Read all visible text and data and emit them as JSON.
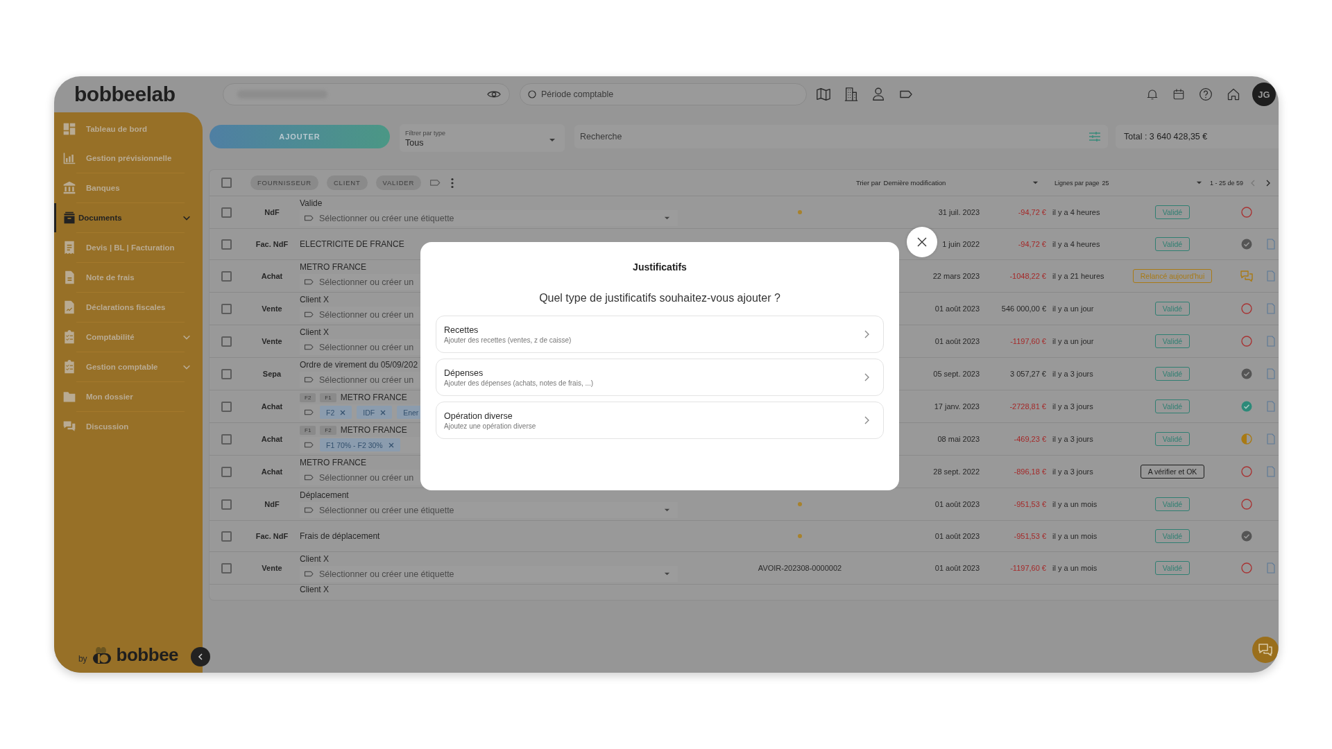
{
  "top_bar": {
    "logo": "bobbeelab",
    "period_field": {
      "placeholder": "Période comptable"
    },
    "avatar": "JG"
  },
  "sidebar": {
    "items": [
      {
        "label": "Tableau de bord",
        "selected": false,
        "expandable": false
      },
      {
        "label": "Gestion prévisionnelle",
        "selected": false,
        "expandable": false
      },
      {
        "label": "Banques",
        "selected": false,
        "expandable": false
      },
      {
        "label": "Documents",
        "selected": true,
        "expandable": true
      },
      {
        "label": "Devis | BL | Facturation",
        "selected": false,
        "expandable": false
      },
      {
        "label": "Note de frais",
        "selected": false,
        "expandable": false
      },
      {
        "label": "Déclarations fiscales",
        "selected": false,
        "expandable": false
      },
      {
        "label": "Comptabilité",
        "selected": false,
        "expandable": true
      },
      {
        "label": "Gestion comptable",
        "selected": false,
        "expandable": true
      },
      {
        "label": "Mon dossier",
        "selected": false,
        "expandable": false
      },
      {
        "label": "Discussion",
        "selected": false,
        "expandable": false
      }
    ],
    "footer": {
      "by": "by",
      "brand": "bobbee"
    }
  },
  "toolbar": {
    "add_button": "AJOUTER",
    "type_filter": {
      "label": "Filtrer par type",
      "value": "Tous"
    },
    "search": {
      "placeholder": "Recherche"
    },
    "total": "Total : 3 640 428,35 €"
  },
  "table": {
    "select_all": {
      "checked": false
    },
    "bulk_actions": [
      {
        "label": "FOURNISSEUR",
        "disabled": true
      },
      {
        "label": "CLIENT",
        "disabled": true
      },
      {
        "label": "VALIDER",
        "disabled": true
      }
    ],
    "sort": {
      "label": "Trier par",
      "value": "Dernière modification"
    },
    "page_size": {
      "label": "Lignes par page",
      "value": "25"
    },
    "pagination": {
      "range": "1 - 25 de 59",
      "previous": {
        "disabled": true
      },
      "next": {
        "disabled": false
      }
    },
    "rows": [
      {
        "kind": "full",
        "checked": false,
        "type": "NdF",
        "label": "Valide",
        "tag_field": {
          "placeholder": "Sélectionner ou créer une étiquette",
          "dropdown": true
        },
        "marker": true,
        "date": "31 juil. 2023",
        "amount": "-94,72 €",
        "negative": true,
        "updated": "il y a 4 heures",
        "badge": {
          "text": "Validé",
          "kind": "validated"
        },
        "status_icon": {
          "kind": "pending"
        },
        "document": false
      },
      {
        "kind": "full",
        "checked": false,
        "type": "Fac. NdF",
        "label": "ELECTRICITE DE FRANCE",
        "marker": false,
        "date": "1 juin 2022",
        "amount": "-94,72 €",
        "negative": true,
        "updated": "il y a 4 heures",
        "badge": {
          "text": "Validé",
          "kind": "validated"
        },
        "status_icon": {
          "kind": "done"
        },
        "document": true
      },
      {
        "kind": "full",
        "checked": false,
        "type": "Achat",
        "label": "METRO FRANCE",
        "tag_field": {
          "placeholder": "Sélectionner ou créer un",
          "dropdown": false
        },
        "marker": false,
        "date": "22 mars 2023",
        "amount": "-1048,22 €",
        "negative": true,
        "updated": "il y a 21 heures",
        "badge": {
          "text": "Relancé aujourd'hui",
          "kind": "reminded"
        },
        "status_icon": {
          "kind": "comment"
        },
        "document": true
      },
      {
        "kind": "full",
        "checked": false,
        "type": "Vente",
        "label": "Client X",
        "tag_field": {
          "placeholder": "Sélectionner ou créer un",
          "dropdown": false
        },
        "marker": false,
        "date": "01 août 2023",
        "amount": "546 000,00 €",
        "negative": false,
        "updated": "il y a un jour",
        "badge": {
          "text": "Validé",
          "kind": "validated"
        },
        "status_icon": {
          "kind": "pending"
        },
        "document": true
      },
      {
        "kind": "full",
        "checked": false,
        "type": "Vente",
        "label": "Client X",
        "tag_field": {
          "placeholder": "Sélectionner ou créer un",
          "dropdown": false
        },
        "marker": false,
        "date": "01 août 2023",
        "amount": "-1197,60 €",
        "negative": true,
        "updated": "il y a un jour",
        "badge": {
          "text": "Validé",
          "kind": "validated"
        },
        "status_icon": {
          "kind": "pending"
        },
        "document": true
      },
      {
        "kind": "full",
        "checked": false,
        "type": "Sepa",
        "label": "Ordre de virement du 05/09/202",
        "tag_field": {
          "placeholder": "Sélectionner ou créer un",
          "dropdown": false
        },
        "marker": false,
        "date": "05 sept. 2023",
        "amount": "3 057,27 €",
        "negative": false,
        "updated": "il y a 3 jours",
        "badge": {
          "text": "Validé",
          "kind": "validated"
        },
        "status_icon": {
          "kind": "done"
        },
        "document": true
      },
      {
        "kind": "full",
        "checked": false,
        "type": "Achat",
        "chips": [
          "F2",
          "F1"
        ],
        "label": "METRO FRANCE",
        "tag_field": {
          "tags": [
            {
              "text": "F2",
              "removable": true
            },
            {
              "text": "IDF",
              "removable": true
            },
            {
              "text": "Ener",
              "removable": false
            }
          ],
          "dropdown": false
        },
        "marker": false,
        "date": "17 janv. 2023",
        "amount": "-2728,81 €",
        "negative": true,
        "updated": "il y a 3 jours",
        "badge": {
          "text": "Validé",
          "kind": "validated"
        },
        "status_icon": {
          "kind": "verified"
        },
        "document": true
      },
      {
        "kind": "full",
        "checked": false,
        "type": "Achat",
        "chips": [
          "F1",
          "F2"
        ],
        "label": "METRO FRANCE",
        "tag_field": {
          "tags": [
            {
              "text": "F1 70% - F2 30%",
              "removable": true
            }
          ],
          "dropdown": false
        },
        "marker": false,
        "date": "08 mai 2023",
        "amount": "-469,23 €",
        "negative": true,
        "updated": "il y a 3 jours",
        "badge": {
          "text": "Validé",
          "kind": "validated"
        },
        "status_icon": {
          "kind": "partial"
        },
        "document": true
      },
      {
        "kind": "full",
        "checked": false,
        "type": "Achat",
        "label": "METRO FRANCE",
        "tag_field": {
          "placeholder": "Sélectionner ou créer un",
          "dropdown": false
        },
        "marker": false,
        "date": "28 sept. 2022",
        "amount": "-896,18 €",
        "negative": true,
        "updated": "il y a 3 jours",
        "badge": {
          "text": "A vérifier et OK",
          "kind": "to-check"
        },
        "status_icon": {
          "kind": "pending"
        },
        "document": true
      },
      {
        "kind": "full",
        "checked": false,
        "type": "NdF",
        "label": "Déplacement",
        "tag_field": {
          "placeholder": "Sélectionner ou créer une étiquette",
          "dropdown": true
        },
        "marker": true,
        "date": "01 août 2023",
        "amount": "-951,53 €",
        "negative": true,
        "updated": "il y a un mois",
        "badge": {
          "text": "Validé",
          "kind": "validated"
        },
        "status_icon": {
          "kind": "pending"
        },
        "document": false
      },
      {
        "kind": "full",
        "checked": false,
        "type": "Fac. NdF",
        "label": "Frais de déplacement",
        "marker": true,
        "date": "01 août 2023",
        "amount": "-951,53 €",
        "negative": true,
        "updated": "il y a un mois",
        "badge": {
          "text": "Validé",
          "kind": "validated"
        },
        "status_icon": {
          "kind": "done"
        },
        "document": false
      },
      {
        "kind": "full",
        "checked": false,
        "type": "Vente",
        "label": "Client X",
        "tag_field": {
          "placeholder": "Sélectionner ou créer une étiquette",
          "dropdown": true
        },
        "marker": false,
        "reference": "AVOIR-202308-0000002",
        "date": "01 août 2023",
        "amount": "-1197,60 €",
        "negative": true,
        "updated": "il y a un mois",
        "badge": {
          "text": "Validé",
          "kind": "validated"
        },
        "status_icon": {
          "kind": "pending"
        },
        "document": true
      },
      {
        "kind": "cut",
        "label": "Client X"
      }
    ]
  },
  "modal": {
    "title": "Justificatifs",
    "question": "Quel type de justificatifs souhaitez-vous ajouter ?",
    "options": [
      {
        "title": "Recettes",
        "description": "Ajouter des recettes (ventes, z de caisse)"
      },
      {
        "title": "Dépenses",
        "description": "Ajouter des dépenses (achats, notes de frais, ...)"
      },
      {
        "title": "Opération diverse",
        "description": "Ajoutez une opération diverse"
      }
    ]
  }
}
